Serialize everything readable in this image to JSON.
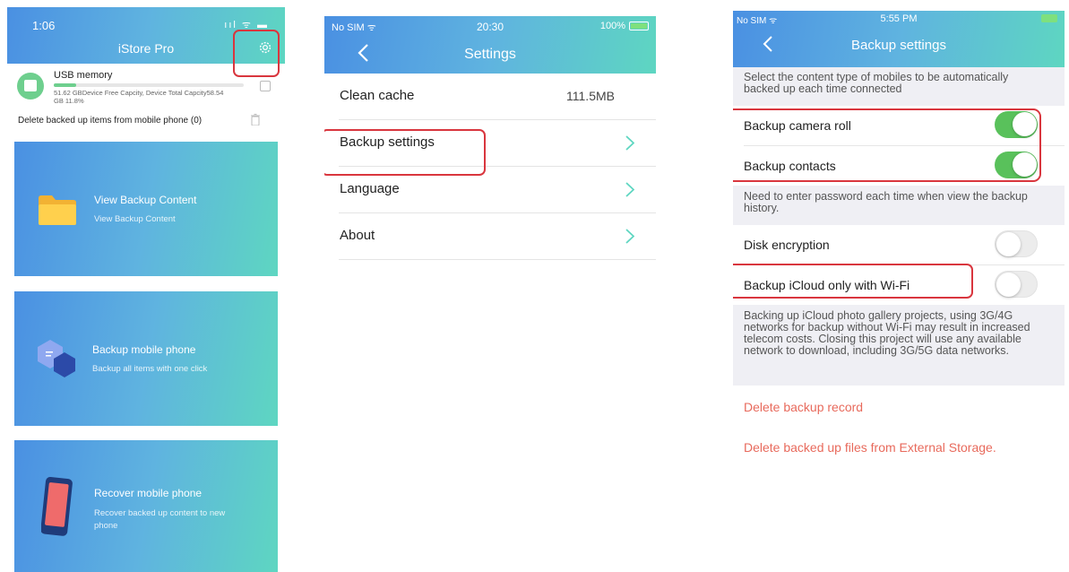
{
  "phone1": {
    "time": "1:06",
    "status_icons": "ııl ᯤ ▬",
    "title": "iStore Pro",
    "usb": {
      "title": "USB memory",
      "capacity": "51.62 GBDevice Free Capcity, Device Total Capcity58.54 GB 11.8%",
      "used_fraction": 0.118
    },
    "delete_label": "Delete backed up items from mobile phone (0)",
    "cards": [
      {
        "title": "View Backup Content",
        "subtitle": "View Backup Content",
        "icon": "folder-icon"
      },
      {
        "title": "Backup mobile phone",
        "subtitle": "Backup all items with one click",
        "icon": "hexagon-icon"
      },
      {
        "title": "Recover mobile phone",
        "subtitle": "Recover backed up content to new phone",
        "icon": "tablet-icon"
      }
    ],
    "icons": {
      "settings": "gear-icon",
      "trash": "trash-icon",
      "usb": "usb-drive-icon"
    }
  },
  "phone2": {
    "carrier": "No SIM",
    "time": "20:30",
    "battery": "100%",
    "title": "Settings",
    "rows": [
      {
        "label": "Clean cache",
        "value": "111.5MB"
      },
      {
        "label": "Backup settings"
      },
      {
        "label": "Language"
      },
      {
        "label": "About"
      }
    ],
    "icons": {
      "back": "chevron-left-icon",
      "row": "chevron-right-icon"
    }
  },
  "phone3": {
    "carrier": "No SIM",
    "time": "5:55 PM",
    "title": "Backup settings",
    "section1_text": "Select the content type of mobiles to be automatically backed up each time connected",
    "toggles1": [
      {
        "label": "Backup camera roll",
        "on": true
      },
      {
        "label": "Backup contacts",
        "on": true
      }
    ],
    "section2_text": "Need to enter password each time when view the backup history.",
    "toggles2": [
      {
        "label": "Disk encryption",
        "on": false
      },
      {
        "label": "Backup iCloud only with Wi-Fi",
        "on": false
      }
    ],
    "section3_text": "Backing up iCloud photo gallery projects, using 3G/4G networks for backup without Wi-Fi may result in increased telecom costs. Closing this project will use any available network to download, including 3G/5G data networks.",
    "actions": [
      "Delete backup record",
      "Delete backed up files from External Storage."
    ],
    "colors": {
      "toggle_on": "#59c15b",
      "danger": "#e86a5c",
      "highlight": "#d9363e"
    }
  },
  "colors": {
    "gradient_start": "#4a90e2",
    "gradient_end": "#5ed6c1"
  }
}
